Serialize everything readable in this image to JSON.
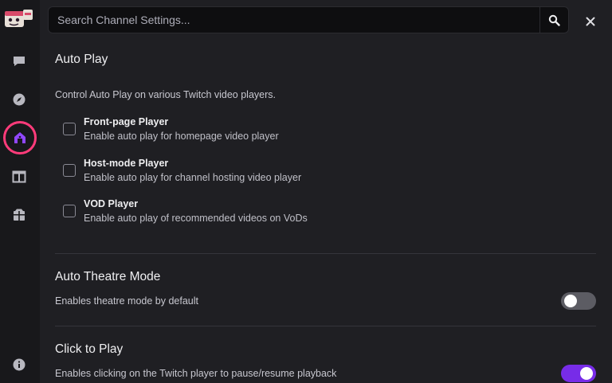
{
  "search": {
    "placeholder": "Search Channel Settings..."
  },
  "sidebar": {
    "items": [
      {
        "icon": "chat-icon"
      },
      {
        "icon": "compass-icon"
      },
      {
        "icon": "home-icon",
        "active": true
      },
      {
        "icon": "layout-icon"
      },
      {
        "icon": "package-icon"
      },
      {
        "icon": "info-icon"
      }
    ]
  },
  "auto_play": {
    "title": "Auto Play",
    "description": "Control Auto Play on various Twitch video players.",
    "options": [
      {
        "title": "Front-page Player",
        "subtitle": "Enable auto play for homepage video player",
        "checked": false
      },
      {
        "title": "Host-mode Player",
        "subtitle": "Enable auto play for channel hosting video player",
        "checked": false
      },
      {
        "title": "VOD Player",
        "subtitle": "Enable auto play of recommended videos on VoDs",
        "checked": false
      }
    ]
  },
  "auto_theatre": {
    "title": "Auto Theatre Mode",
    "description": "Enables theatre mode by default",
    "enabled": false
  },
  "click_to_play": {
    "title": "Click to Play",
    "description": "Enables clicking on the Twitch player to pause/resume playback",
    "enabled": true
  },
  "colors": {
    "accent": "#772ce8",
    "highlight_ring": "#ff3b7a",
    "background": "#1f1f23",
    "sidebar": "#18181b"
  }
}
